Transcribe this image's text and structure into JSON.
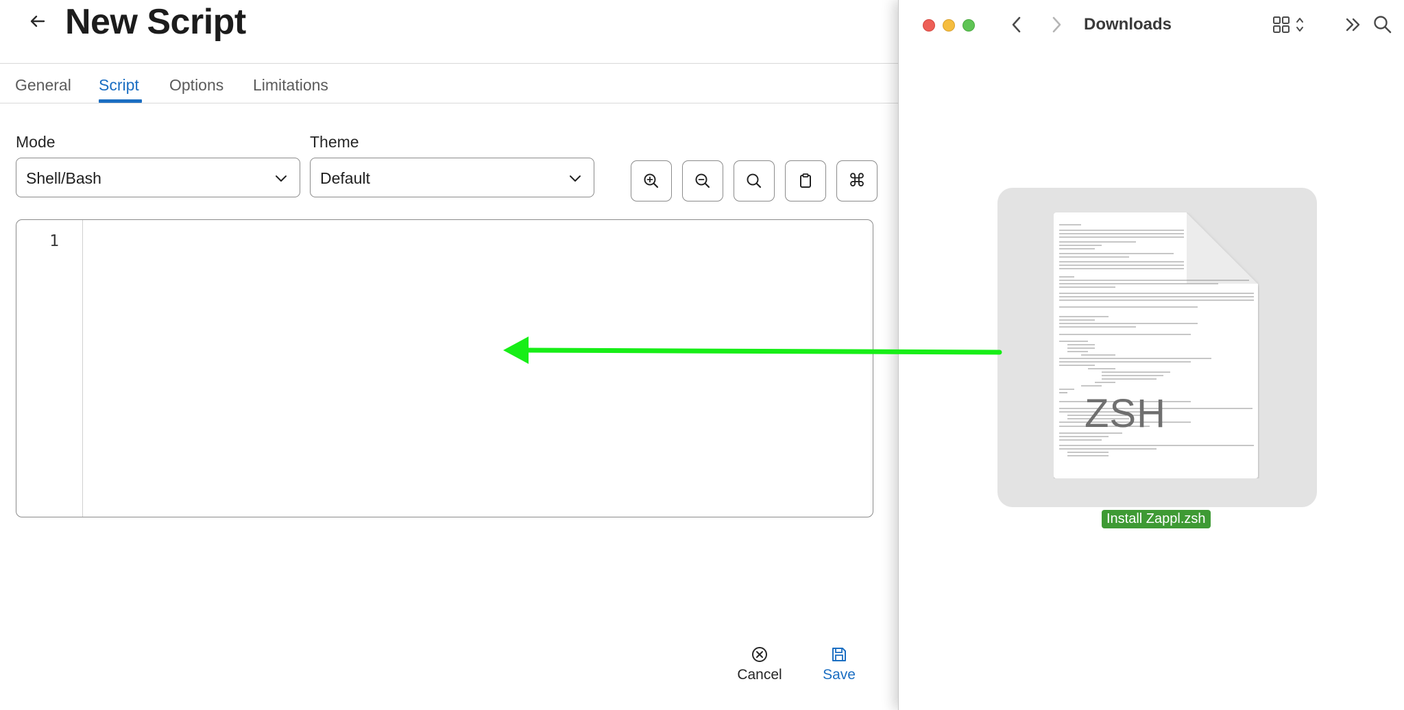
{
  "header": {
    "title": "New Script"
  },
  "tabs": [
    {
      "label": "General"
    },
    {
      "label": "Script"
    },
    {
      "label": "Options"
    },
    {
      "label": "Limitations"
    }
  ],
  "active_tab": "Script",
  "mode": {
    "label": "Mode",
    "value": "Shell/Bash"
  },
  "theme": {
    "label": "Theme",
    "value": "Default"
  },
  "toolbar": {
    "icons": [
      "zoom-in-icon",
      "zoom-out-icon",
      "search-icon",
      "clipboard-icon",
      "command-icon"
    ],
    "command_glyph": "⌘"
  },
  "editor": {
    "line_numbers": [
      "1"
    ],
    "content": ""
  },
  "footer": {
    "cancel_label": "Cancel",
    "save_label": "Save"
  },
  "finder": {
    "title": "Downloads",
    "file": {
      "name": "Install Zappl.zsh",
      "type_badge": "ZSH"
    }
  },
  "colors": {
    "accent": "#1b6ec2",
    "drag_arrow": "#17ee17",
    "file_label_bg": "#3e9a34"
  }
}
